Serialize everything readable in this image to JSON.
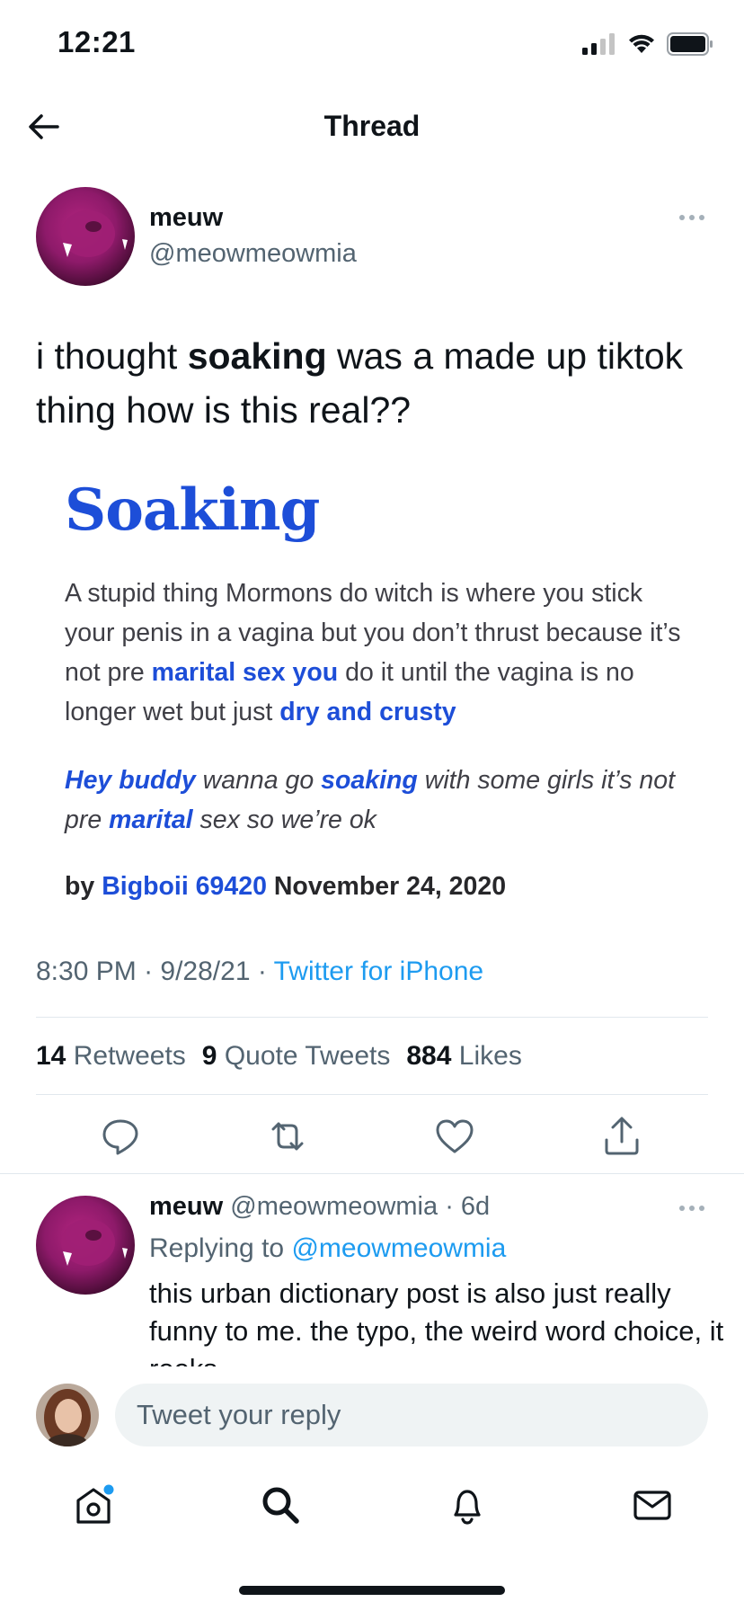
{
  "status_bar": {
    "time": "12:21"
  },
  "header": {
    "title": "Thread"
  },
  "tweet": {
    "author_name": "meuw",
    "author_handle": "@meowmeowmia",
    "text_before": "i thought ",
    "text_bold": "soaking",
    "text_after": " was a made up tiktok thing how is this real??",
    "image": {
      "word": "Soaking",
      "definition": {
        "p1": "A stupid thing Mormons do witch is where you stick your penis in a vagina but you don’t thrust because it’s not pre ",
        "link1": "marital sex you",
        "p2": " do it until the vagina is no longer wet but just ",
        "link2": "dry and crusty"
      },
      "example": {
        "link1": "Hey buddy",
        "p1": " wanna go ",
        "link2": "soaking",
        "p2": " with some girls it’s not pre ",
        "link3": "marital",
        "p3": " sex so we’re ok"
      },
      "byline": {
        "by": "by ",
        "author": "Bigboii 69420",
        "date": " November 24, 2020"
      }
    },
    "time": "8:30 PM",
    "date": "9/28/21",
    "source": "Twitter for iPhone",
    "stats": {
      "retweets_count": "14",
      "retweets_label": "Retweets",
      "quotes_count": "9",
      "quotes_label": "Quote Tweets",
      "likes_count": "884",
      "likes_label": "Likes"
    }
  },
  "reply": {
    "author_name": "meuw",
    "author_handle": "@meowmeowmia",
    "age": "6d",
    "replying_label": "Replying to ",
    "replying_to": "@meowmeowmia",
    "text": "this urban dictionary post is also just really funny to me. the typo, the weird word choice, it reeks"
  },
  "composer": {
    "placeholder": "Tweet your reply"
  },
  "colors": {
    "accent": "#1d9bf0",
    "ud_blue": "#1d4ed8",
    "avatar_magenta": "#8e1a6a"
  },
  "tab_bar": {
    "icons": [
      "home-icon",
      "search-icon",
      "notifications-icon",
      "messages-icon"
    ],
    "home_has_unread_dot": true
  }
}
